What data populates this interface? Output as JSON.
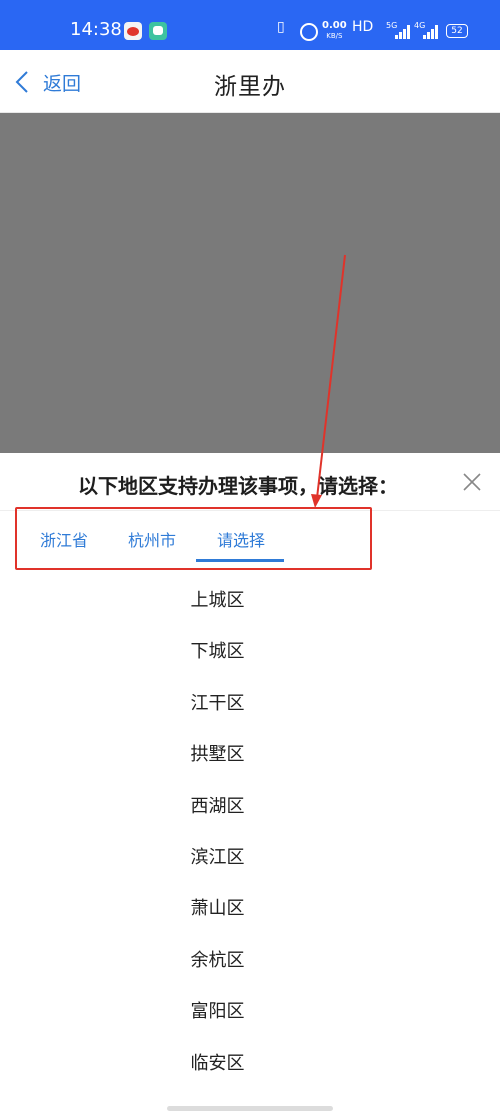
{
  "status_bar": {
    "time": "14:38",
    "speed_value": "0.00",
    "speed_unit": "KB/S",
    "hd": "HD",
    "net1": "5G",
    "net2": "4G",
    "battery": "52"
  },
  "header": {
    "back_label": "返回",
    "title": "浙里办"
  },
  "sheet": {
    "title": "以下地区支持办理该事项，请选择：",
    "tabs": [
      {
        "label": "浙江省"
      },
      {
        "label": "杭州市"
      },
      {
        "label": "请选择",
        "active": true
      }
    ],
    "districts": [
      "上城区",
      "下城区",
      "江干区",
      "拱墅区",
      "西湖区",
      "滨江区",
      "萧山区",
      "余杭区",
      "富阳区",
      "临安区"
    ]
  },
  "colors": {
    "status_bar": "#2a67f3",
    "accent": "#2f7bd7",
    "annotation": "#e0332a",
    "overlay": "#7a7a7a"
  }
}
